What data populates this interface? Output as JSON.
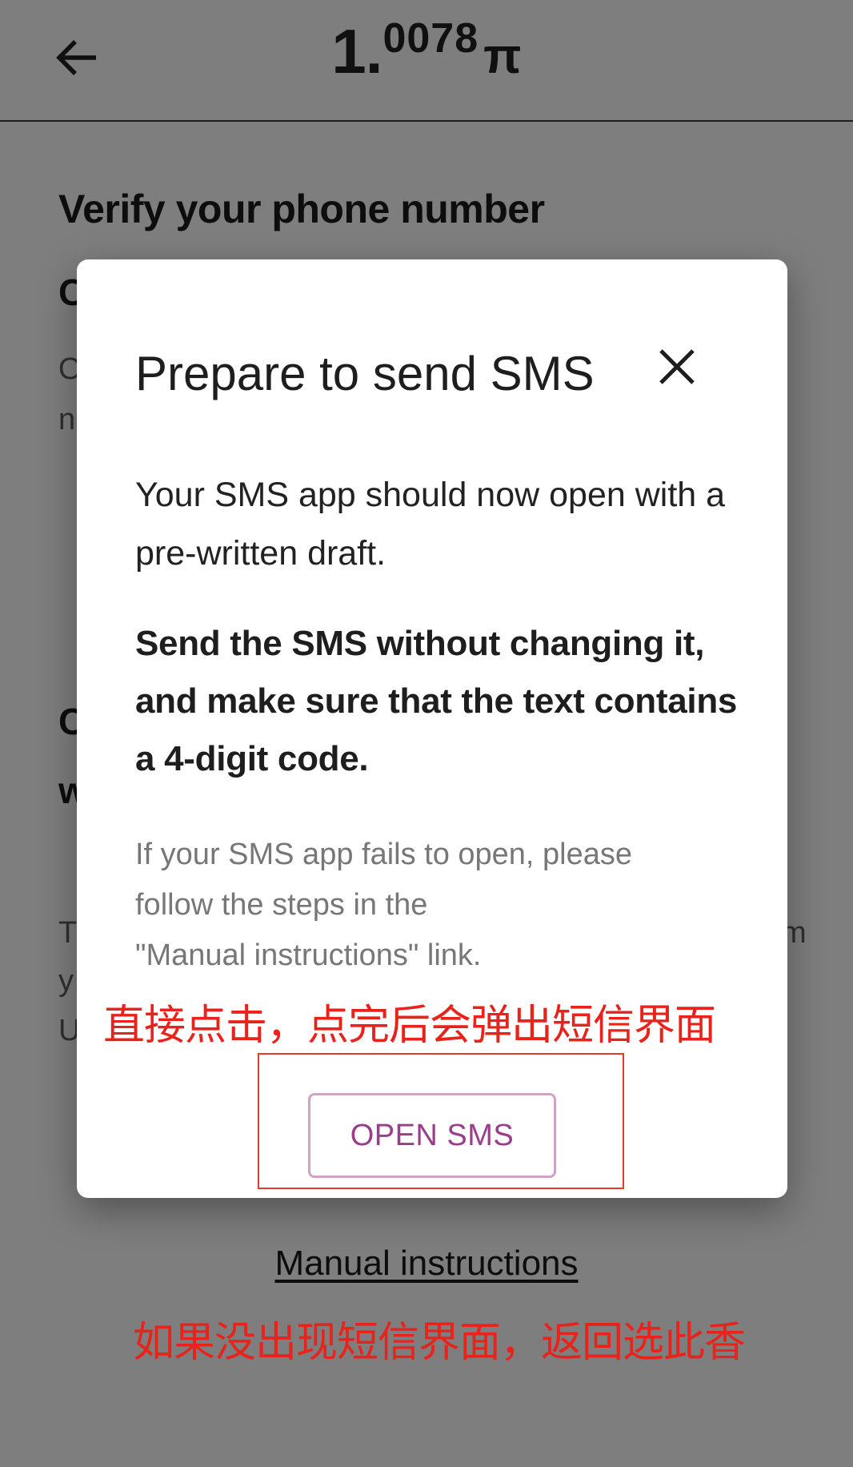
{
  "header": {
    "balance_int": "1",
    "balance_dot": ".",
    "balance_frac": "0078",
    "currency_symbol": "π"
  },
  "background": {
    "title": "Verify your phone number",
    "fragments": [
      "C",
      "O",
      "n",
      "C",
      "w",
      "T",
      "m",
      "y",
      "U"
    ],
    "manual_link": "Manual instructions"
  },
  "dialog": {
    "title": "Prepare to send SMS",
    "p1": "Your SMS app should now open with a pre-written draft.",
    "p2": "Send the SMS without changing it, and make sure that the text contains a 4-digit code.",
    "p3_line1": "If your SMS app fails to open, please",
    "p3_line2": "follow the steps in the",
    "p3_line3": "\"Manual instructions\" link.",
    "button_label": "OPEN SMS"
  },
  "annotations": {
    "a1": "直接点击，点完后会弹出短信界面",
    "a2": "如果没出现短信界面，返回选此香"
  },
  "colors": {
    "annotation": "#e8231b",
    "button_text": "#9a3e8c",
    "button_border": "#d2a1c8"
  },
  "icons": {
    "back": "arrow-left",
    "close": "close-x"
  }
}
